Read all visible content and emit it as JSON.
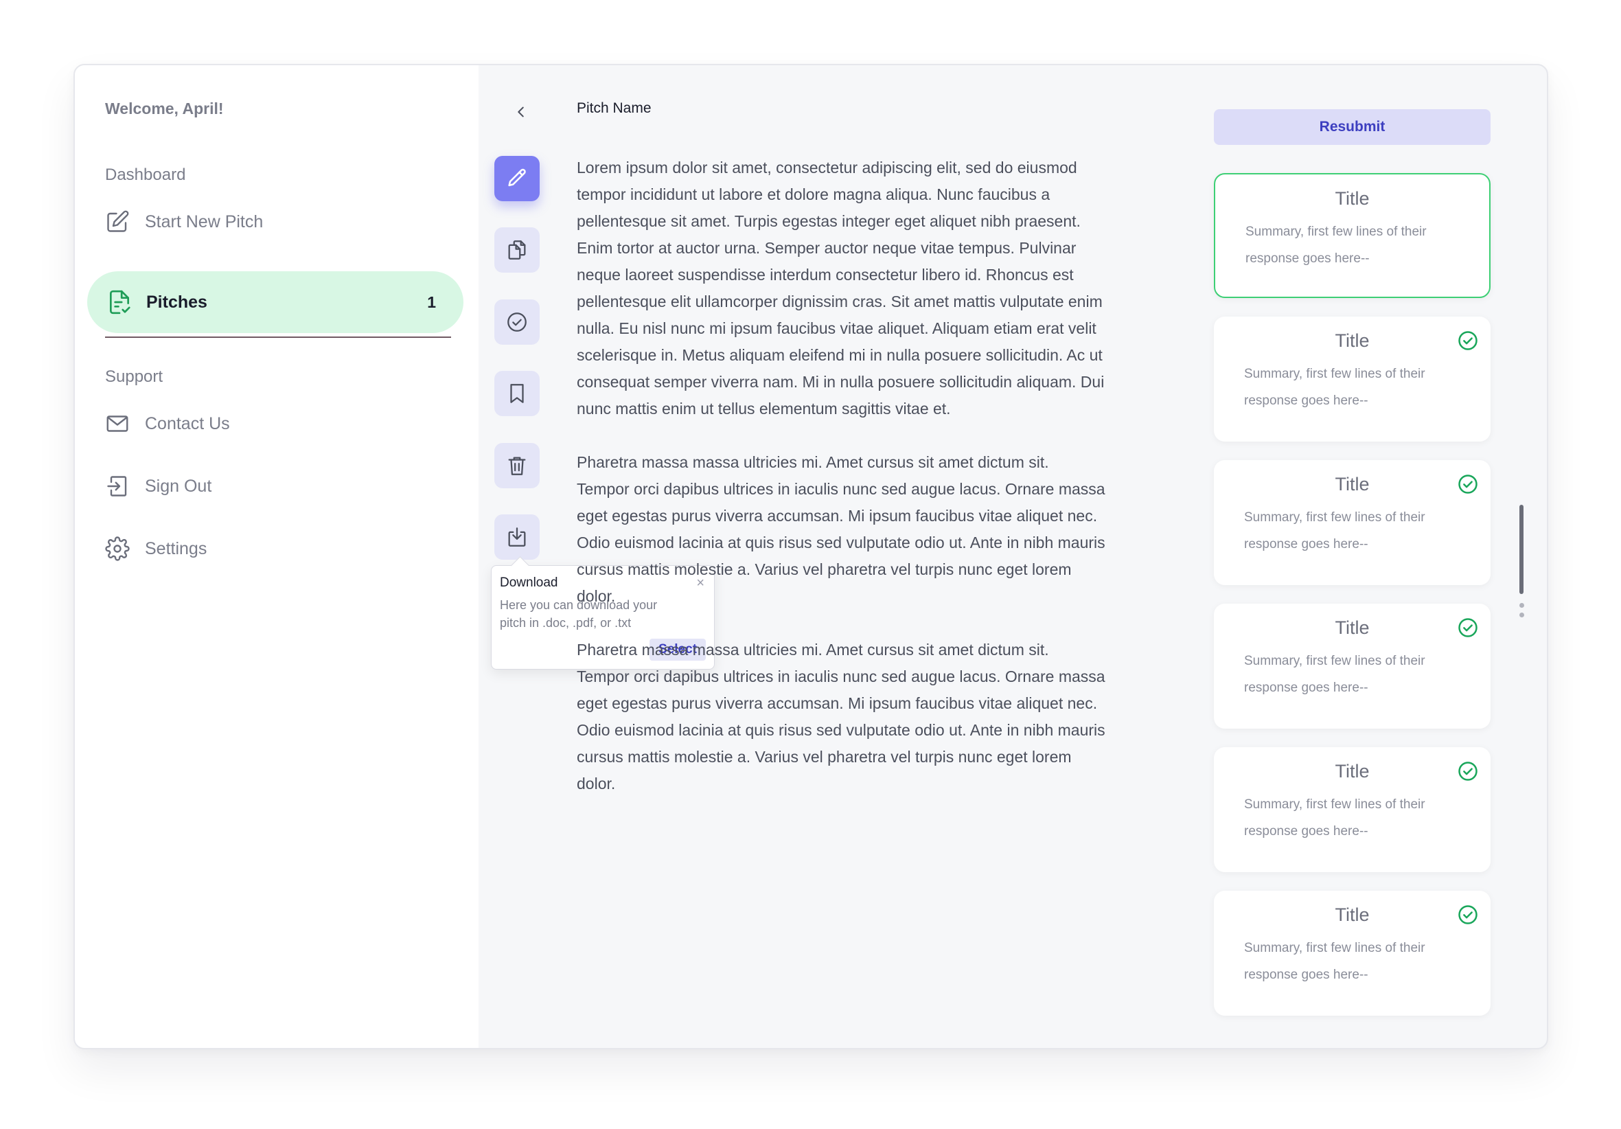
{
  "sidebar": {
    "welcome": "Welcome, April!",
    "sections": {
      "dashboard": "Dashboard",
      "support": "Support"
    },
    "items": [
      {
        "label": "Start New Pitch",
        "icon": "edit-icon"
      },
      {
        "label": "Pitches",
        "icon": "document-check-icon",
        "count": "1",
        "active": true
      },
      {
        "label": "Contact Us",
        "icon": "mail-icon"
      },
      {
        "label": "Sign Out",
        "icon": "sign-out-icon"
      },
      {
        "label": "Settings",
        "icon": "gear-icon"
      }
    ]
  },
  "toolbar": {
    "tools": [
      {
        "name": "edit",
        "icon": "pencil-icon",
        "active": true
      },
      {
        "name": "copy",
        "icon": "copy-icon"
      },
      {
        "name": "approve",
        "icon": "check-circle-icon"
      },
      {
        "name": "bookmark",
        "icon": "bookmark-icon"
      },
      {
        "name": "delete",
        "icon": "trash-icon"
      },
      {
        "name": "download",
        "icon": "download-icon"
      }
    ],
    "tooltip": {
      "title": "Download",
      "body": "Here you can download your pitch in .doc, .pdf, or .txt",
      "select_label": "Select",
      "close": "×"
    }
  },
  "pitch": {
    "name": "Pitch Name",
    "paragraphs": [
      "Lorem ipsum dolor sit amet, consectetur adipiscing elit, sed do eiusmod tempor incididunt ut labore et dolore magna aliqua. Nunc faucibus a pellentesque sit amet. Turpis egestas integer eget aliquet nibh praesent. Enim tortor at auctor urna. Semper auctor neque vitae tempus. Pulvinar neque laoreet suspendisse interdum consectetur libero id. Rhoncus est pellentesque elit ullamcorper dignissim cras. Sit amet mattis vulputate enim nulla. Eu nisl nunc mi ipsum faucibus vitae aliquet. Aliquam etiam erat velit scelerisque in. Metus aliquam eleifend mi in nulla posuere sollicitudin. Ac ut consequat semper viverra nam. Mi in nulla posuere sollicitudin aliquam. Dui nunc mattis enim ut tellus elementum sagittis vitae et.",
      "Pharetra massa massa ultricies mi. Amet cursus sit amet dictum sit. Tempor orci dapibus ultrices in iaculis nunc sed augue lacus. Ornare massa eget egestas purus viverra accumsan. Mi ipsum faucibus vitae aliquet nec. Odio euismod lacinia at quis risus sed vulputate odio ut. Ante in nibh mauris cursus mattis molestie a. Varius vel pharetra vel turpis nunc eget lorem dolor.",
      "Pharetra massa massa ultricies mi. Amet cursus sit amet dictum sit. Tempor orci dapibus ultrices in iaculis nunc sed augue lacus. Ornare massa eget egestas purus viverra accumsan. Mi ipsum faucibus vitae aliquet nec. Odio euismod lacinia at quis risus sed vulputate odio ut. Ante in nibh mauris cursus mattis molestie a. Varius vel pharetra vel turpis nunc eget lorem dolor."
    ]
  },
  "responses": {
    "resubmit_label": "Resubmit",
    "cards": [
      {
        "title": "Title",
        "summary": "Summary, first few lines of their response goes here--",
        "selected": true,
        "checked": false
      },
      {
        "title": "Title",
        "summary": "Summary, first few lines of their response goes here--",
        "checked": true
      },
      {
        "title": "Title",
        "summary": "Summary, first few lines of their response goes here--",
        "checked": true
      },
      {
        "title": "Title",
        "summary": "Summary, first few lines of their response goes here--",
        "checked": true
      },
      {
        "title": "Title",
        "summary": "Summary, first few lines of their response goes here--",
        "checked": true
      },
      {
        "title": "Title",
        "summary": "Summary, first few lines of their response goes here--",
        "checked": true
      }
    ]
  },
  "colors": {
    "accent": "#7c7df2",
    "active_nav_bg": "#d8f7e4",
    "check_green": "#19a65a",
    "selected_border": "#3ecf75"
  }
}
